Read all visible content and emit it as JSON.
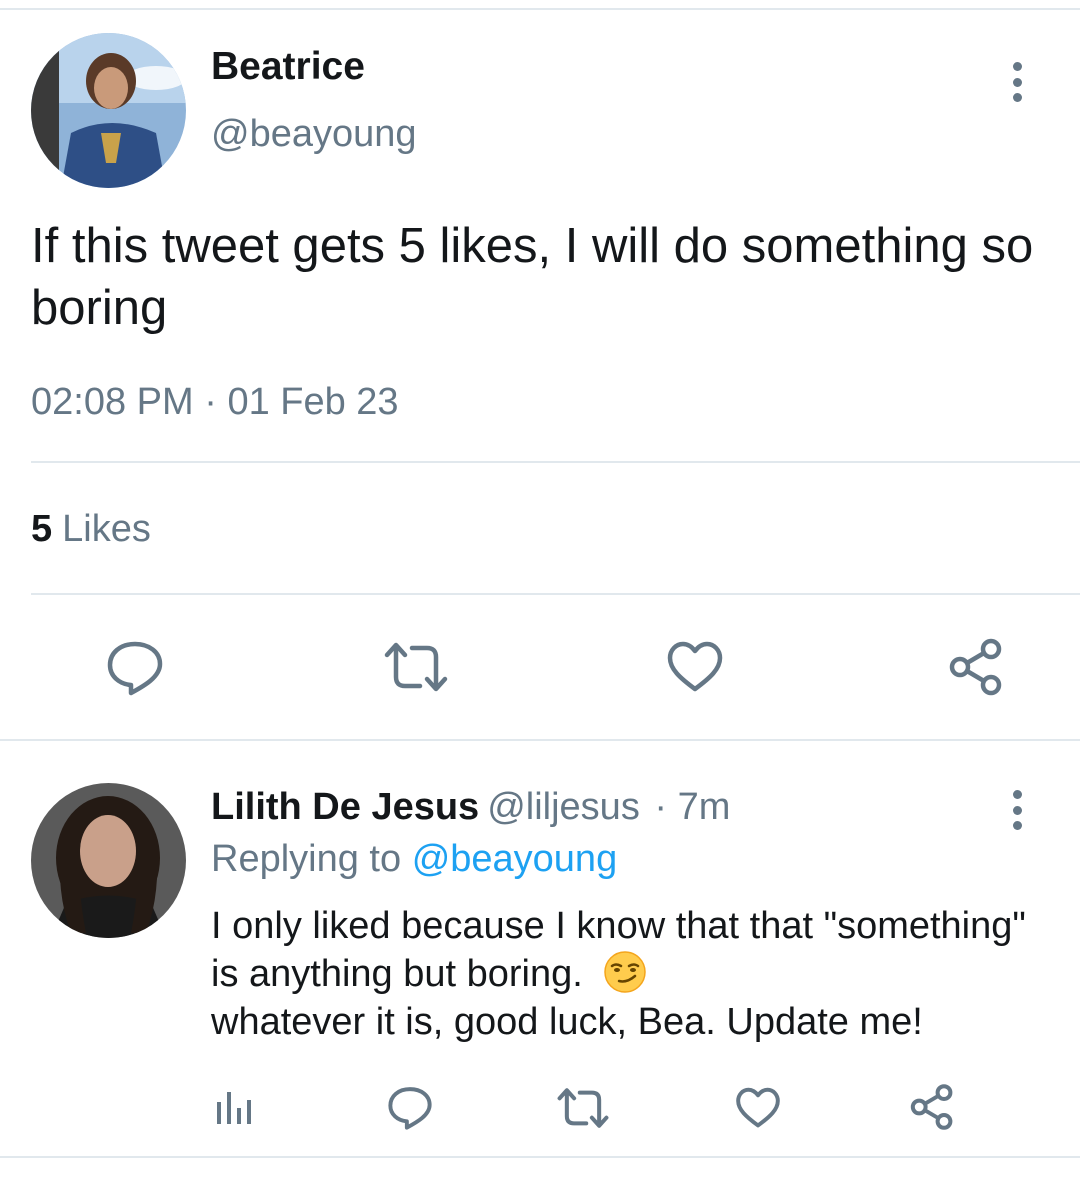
{
  "tweet": {
    "author": {
      "display_name": "Beatrice",
      "handle": "@beayoung"
    },
    "text": "If this tweet gets 5 likes, I will do something so boring",
    "time": "02:08 PM",
    "separator": "·",
    "date": "01 Feb 23",
    "likes_count": "5",
    "likes_label": "Likes",
    "actions": [
      "reply-icon",
      "retweet-icon",
      "like-icon",
      "share-icon"
    ]
  },
  "reply": {
    "author": {
      "display_name": "Lilith De Jesus",
      "handle": "@liljesus"
    },
    "age": "· 7m",
    "replying_prefix": "Replying to",
    "replying_handle": "@beayoung",
    "text_before_emoji": "I only liked because I know that that \"something\" is anything but boring.",
    "emoji": "smirking-face-emoji",
    "text_after_emoji": "whatever it is, good luck, Bea. Update me!",
    "actions": [
      "analytics-icon",
      "reply-icon",
      "retweet-icon",
      "like-icon",
      "share-icon"
    ]
  },
  "colors": {
    "text_primary": "#14171a",
    "text_secondary": "#657786",
    "link": "#1da1f2",
    "divider": "#e1e8ed"
  }
}
